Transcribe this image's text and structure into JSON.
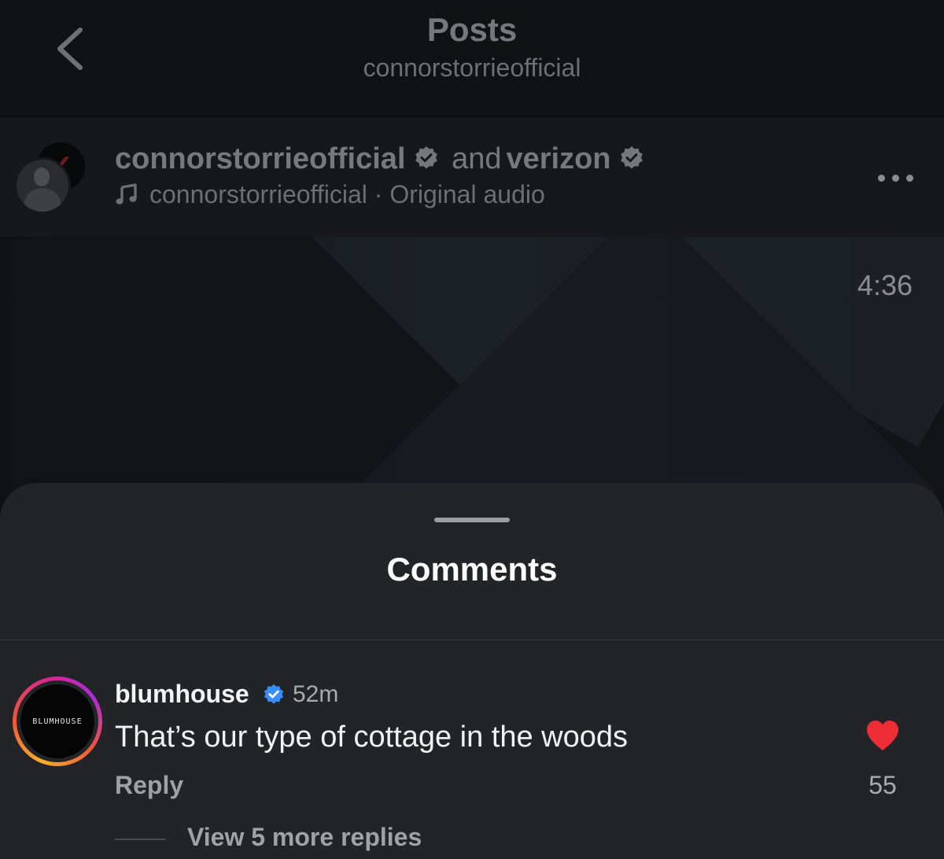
{
  "header": {
    "title": "Posts",
    "subtitle": "connorstorrieofficial"
  },
  "post": {
    "author": "connorstorrieofficial",
    "conjunction": "and",
    "collaborator": "verizon",
    "audio_owner": "connorstorrieofficial",
    "audio_separator": "·",
    "audio_label": "Original audio",
    "duration": "4:36"
  },
  "comments": {
    "title": "Comments",
    "items": [
      {
        "username": "blumhouse",
        "verified": true,
        "time": "52m",
        "text": "That’s our type of cottage in the woods",
        "reply_label": "Reply",
        "likes": "55",
        "liked": true,
        "avatar_text": "BLUMHOUSE",
        "view_replies": "View 5 more replies"
      }
    ]
  },
  "colors": {
    "heart": "#ee2d37",
    "verified_blue": "#3a8dfe",
    "sheet_bg": "#232428"
  },
  "icons": [
    "back-chevron-icon",
    "verified-badge-icon",
    "music-note-icon",
    "more-options-icon",
    "heart-icon"
  ]
}
